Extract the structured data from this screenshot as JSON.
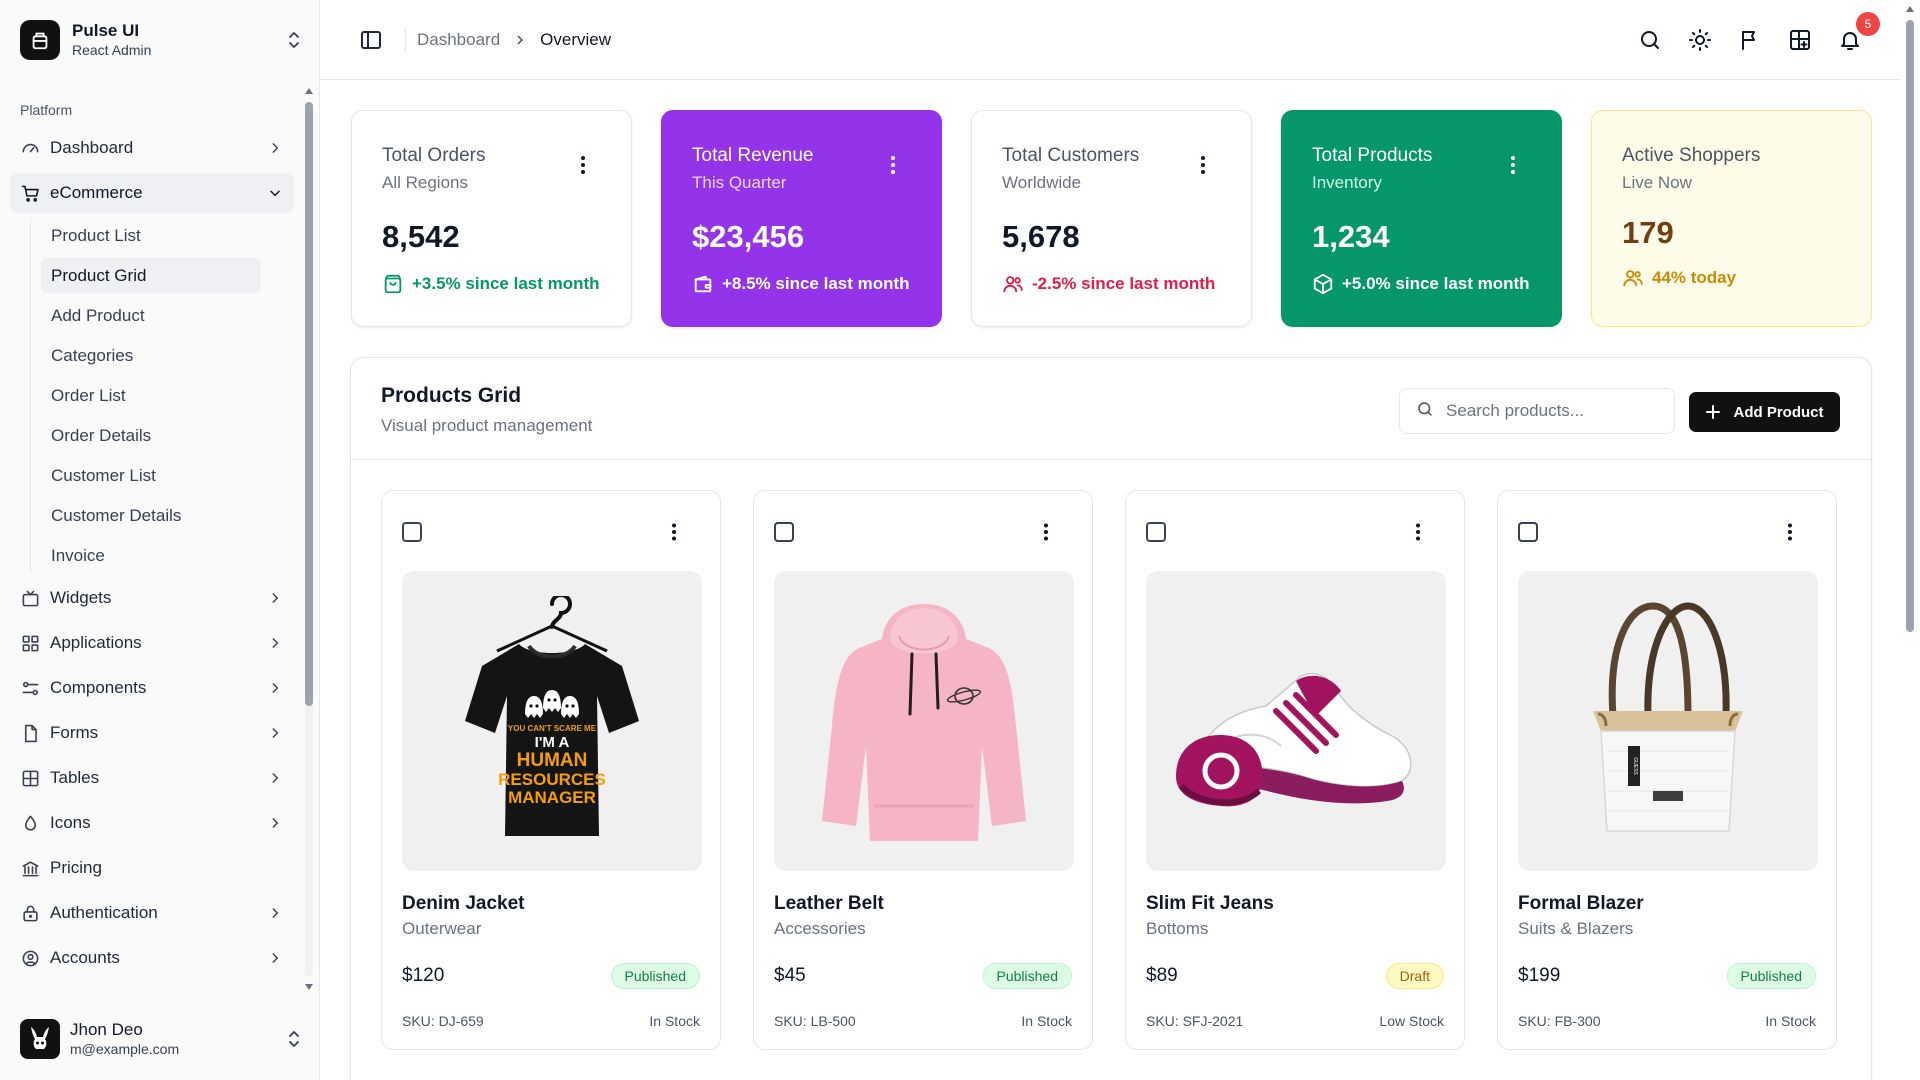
{
  "brand": {
    "title": "Pulse UI",
    "subtitle": "React Admin"
  },
  "sidebar": {
    "section": "Platform",
    "items": [
      {
        "label": "Dashboard",
        "icon": "gauge-icon"
      },
      {
        "label": "eCommerce",
        "icon": "cart-icon"
      },
      {
        "label": "Widgets",
        "icon": "widget-icon"
      },
      {
        "label": "Applications",
        "icon": "grid-icon"
      },
      {
        "label": "Components",
        "icon": "components-icon"
      },
      {
        "label": "Forms",
        "icon": "file-icon"
      },
      {
        "label": "Tables",
        "icon": "table-icon"
      },
      {
        "label": "Icons",
        "icon": "droplet-icon"
      },
      {
        "label": "Pricing",
        "icon": "bank-icon"
      },
      {
        "label": "Authentication",
        "icon": "lock-icon"
      },
      {
        "label": "Accounts",
        "icon": "user-circle-icon"
      }
    ],
    "ecommerce_sub": [
      "Product List",
      "Product Grid",
      "Add Product",
      "Categories",
      "Order List",
      "Order Details",
      "Customer List",
      "Customer Details",
      "Invoice"
    ]
  },
  "user": {
    "name": "Jhon Deo",
    "email": "m@example.com"
  },
  "breadcrumb": {
    "first": "Dashboard",
    "current": "Overview"
  },
  "notifications": {
    "count": "5"
  },
  "stats": [
    {
      "title": "Total Orders",
      "subtitle": "All Regions",
      "value": "8,542",
      "trend": "+3.5% since last month",
      "trend_color": "#059669",
      "icon": "shopping-bag-icon"
    },
    {
      "title": "Total Revenue",
      "subtitle": "This Quarter",
      "value": "$23,456",
      "trend": "+8.5% since last month",
      "trend_color": "#ffffff",
      "icon": "wallet-icon"
    },
    {
      "title": "Total Customers",
      "subtitle": "Worldwide",
      "value": "5,678",
      "trend": "-2.5% since last month",
      "trend_color": "#e11d48",
      "icon": "users-icon"
    },
    {
      "title": "Total Products",
      "subtitle": "Inventory",
      "value": "1,234",
      "trend": "+5.0% since last month",
      "trend_color": "#ffffff",
      "icon": "box-icon"
    },
    {
      "title": "Active Shoppers",
      "subtitle": "Live Now",
      "value": "179",
      "trend": "44% today",
      "trend_color": "#ca8a04",
      "icon": "users-icon"
    }
  ],
  "products_panel": {
    "title": "Products Grid",
    "subtitle": "Visual product management",
    "search_placeholder": "Search products...",
    "add_label": "Add Product"
  },
  "products": [
    {
      "name": "Denim Jacket",
      "category": "Outerwear",
      "price": "$120",
      "status": "Published",
      "sku": "SKU: DJ-659",
      "stock": "In Stock",
      "image": "black-tshirt",
      "tshirt_text": [
        "YOU CAN'T SCARE ME",
        "I'M A",
        "HUMAN",
        "RESOURCES",
        "MANAGER"
      ]
    },
    {
      "name": "Leather Belt",
      "category": "Accessories",
      "price": "$45",
      "status": "Published",
      "sku": "SKU: LB-500",
      "stock": "In Stock",
      "image": "pink-hoodie"
    },
    {
      "name": "Slim Fit Jeans",
      "category": "Bottoms",
      "price": "$89",
      "status": "Draft",
      "sku": "SKU: SFJ-2021",
      "stock": "Low Stock",
      "image": "magenta-sneakers"
    },
    {
      "name": "Formal Blazer",
      "category": "Suits & Blazers",
      "price": "$199",
      "status": "Published",
      "sku": "SKU: FB-300",
      "stock": "In Stock",
      "image": "white-tote-bag",
      "bag_text": "GUESS"
    }
  ],
  "colors": {
    "accent_purple": "#9333ea",
    "accent_green": "#059669",
    "accent_yellow_bg": "#fefce8",
    "badge_red": "#ef4444"
  }
}
